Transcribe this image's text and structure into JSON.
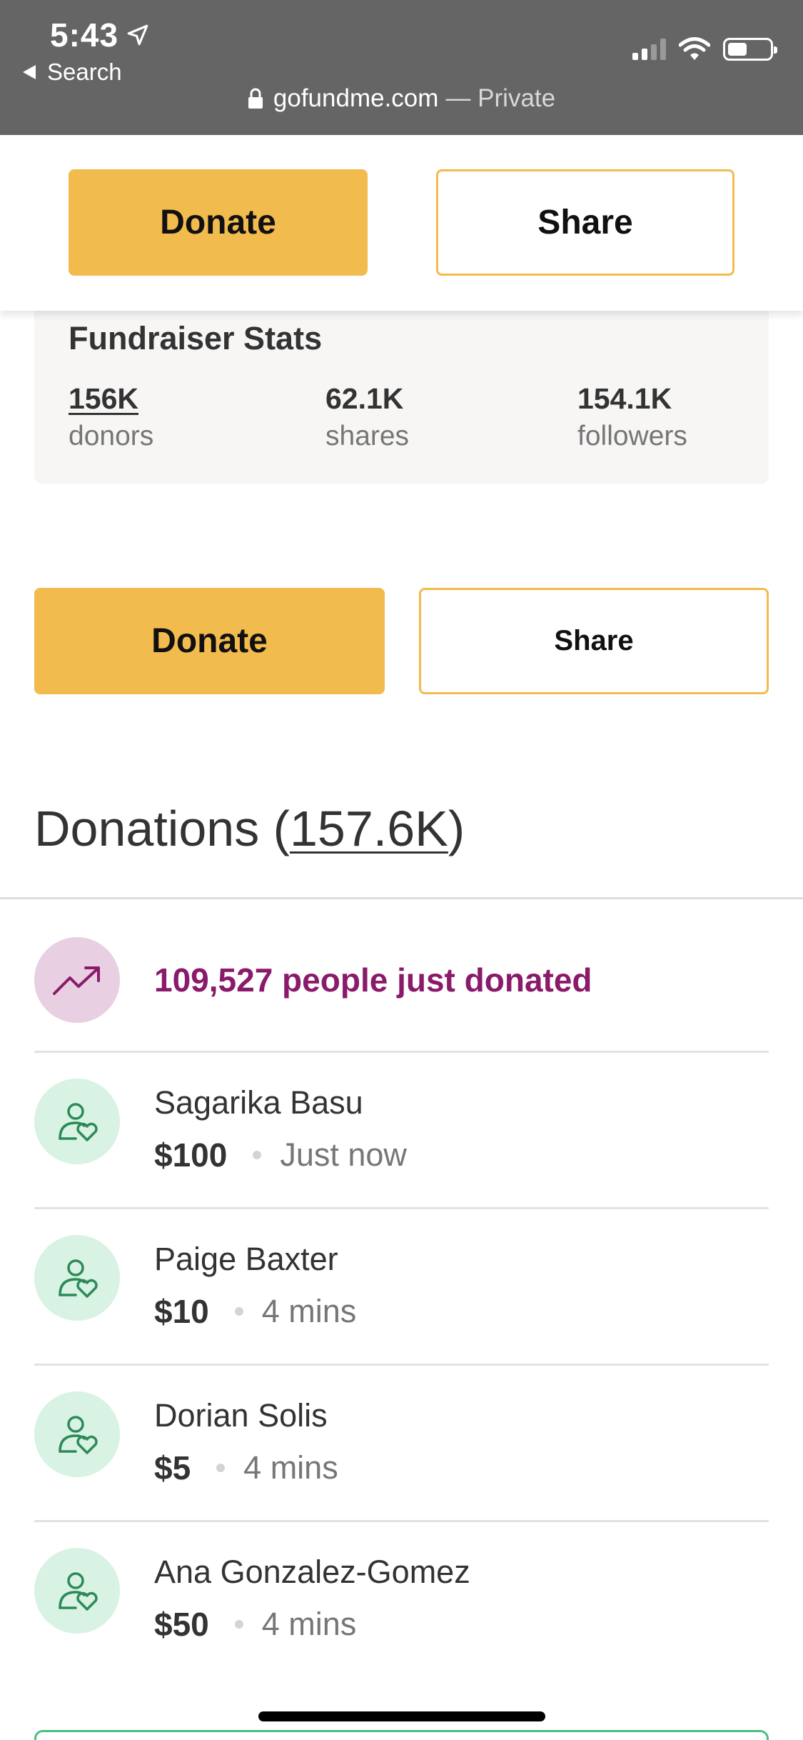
{
  "status_bar": {
    "time": "5:43",
    "back_label": "Search",
    "url_domain": "gofundme.com",
    "url_private": "— Private"
  },
  "sticky_bar": {
    "donate_label": "Donate",
    "share_label": "Share"
  },
  "stats": {
    "title": "Fundraiser Stats",
    "items": [
      {
        "value": "156K",
        "label": "donors"
      },
      {
        "value": "62.1K",
        "label": "shares"
      },
      {
        "value": "154.1K",
        "label": "followers"
      }
    ]
  },
  "actions": {
    "donate_label": "Donate",
    "share_label": "Share"
  },
  "donations": {
    "title_prefix": "Donations (",
    "count": "157.6K",
    "title_suffix": ")",
    "trend_text": "109,527 people just donated",
    "items": [
      {
        "name": "Sagarika Basu",
        "amount": "$100",
        "time": "Just now"
      },
      {
        "name": "Paige Baxter",
        "amount": "$10",
        "time": "4 mins"
      },
      {
        "name": "Dorian Solis",
        "amount": "$5",
        "time": "4 mins"
      },
      {
        "name": "Ana Gonzalez-Gomez",
        "amount": "$50",
        "time": "4 mins"
      }
    ]
  },
  "colors": {
    "donate_yellow": "#f2bb4e",
    "trend_purple": "#8a1a6a",
    "avatar_green": "#d8f2e3",
    "avatar_pink": "#e8cfe2"
  },
  "icons": [
    "location-arrow-icon",
    "back-triangle-icon",
    "lock-icon",
    "signal-icon",
    "wifi-icon",
    "battery-icon",
    "trend-up-icon",
    "donor-heart-icon"
  ]
}
